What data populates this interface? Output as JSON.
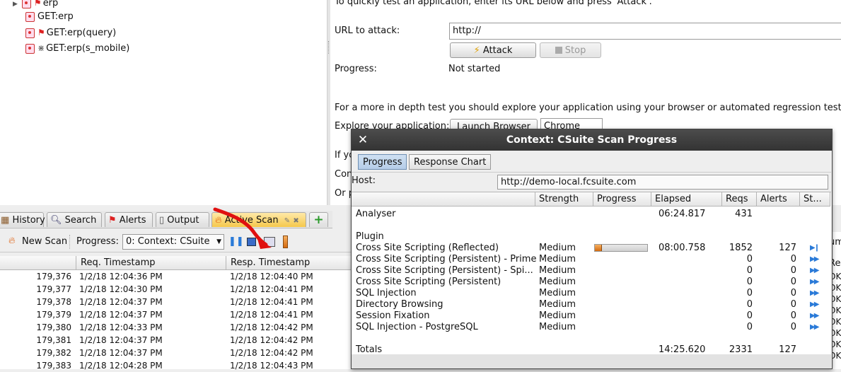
{
  "tree": {
    "items": [
      {
        "label": "erp",
        "type": "folder"
      },
      {
        "label": "GET:erp",
        "type": "plain"
      },
      {
        "label": "GET:erp(query)",
        "type": "flag"
      },
      {
        "label": "GET:erp(s_mobile)",
        "type": "bug"
      }
    ]
  },
  "quick": {
    "intro": "To quickly test an application, enter its URL below and press 'Attack'.",
    "url_label": "URL to attack:",
    "url_value": "http://",
    "attack_label": "Attack",
    "stop_label": "Stop",
    "progress_label": "Progress:",
    "progress_value": "Not started",
    "explore_text": "For a more in depth test you should explore your application using your browser or automated regression tests whi",
    "explore_label": "Explore your application:",
    "launch_label": "Launch Browser",
    "browser_value": "Chrome",
    "if_prefix": "If yo",
    "con_prefix": "Con",
    "or_prefix": "Or p"
  },
  "tabs": [
    {
      "label": "History",
      "icon": "history-icon"
    },
    {
      "label": "Search",
      "icon": "search-icon"
    },
    {
      "label": "Alerts",
      "icon": "alert-flag-icon"
    },
    {
      "label": "Output",
      "icon": "document-icon"
    },
    {
      "label": "Active Scan",
      "icon": "flame-icon",
      "active": true
    }
  ],
  "toolbar": {
    "new_scan": "New Scan",
    "progress_label": "Progress:",
    "progress_select": "0: Context: CSuite"
  },
  "table": {
    "headers": [
      "",
      "Req. Timestamp",
      "Resp. Timestamp"
    ],
    "rows": [
      {
        "id": "179,376",
        "req": "1/2/18 12:04:36 PM",
        "resp": "1/2/18 12:04:40 PM",
        "code": "OK"
      },
      {
        "id": "179,377",
        "req": "1/2/18 12:04:30 PM",
        "resp": "1/2/18 12:04:41 PM",
        "code": "OK"
      },
      {
        "id": "179,378",
        "req": "1/2/18 12:04:37 PM",
        "resp": "1/2/18 12:04:41 PM",
        "code": "OK"
      },
      {
        "id": "179,379",
        "req": "1/2/18 12:04:37 PM",
        "resp": "1/2/18 12:04:41 PM",
        "code": "OK"
      },
      {
        "id": "179,380",
        "req": "1/2/18 12:04:33 PM",
        "resp": "1/2/18 12:04:42 PM",
        "code": "OK"
      },
      {
        "id": "179,381",
        "req": "1/2/18 12:04:37 PM",
        "resp": "1/2/18 12:04:42 PM",
        "code": "OK"
      },
      {
        "id": "179,382",
        "req": "1/2/18 12:04:37 PM",
        "resp": "1/2/18 12:04:42 PM",
        "code": "OK"
      },
      {
        "id": "179,383",
        "req": "1/2/18 12:04:28 PM",
        "resp": "1/2/18 12:04:43 PM",
        "code": "OK"
      }
    ],
    "right_header_fragment": "Rea",
    "right_top_fragment": "um"
  },
  "dialog": {
    "title": "Context: CSuite Scan Progress",
    "tabs": [
      "Progress",
      "Response Chart"
    ],
    "host_label": "Host:",
    "host_value": "http://demo-local.fcsuite.com",
    "headers": [
      "",
      "Strength",
      "Progress",
      "Elapsed",
      "Reqs",
      "Alerts",
      "St..."
    ],
    "analyser": {
      "name": "Analyser",
      "elapsed": "06:24.817",
      "reqs": "431"
    },
    "plugin_heading": "Plugin",
    "plugins": [
      {
        "name": "Cross Site Scripting (Reflected)",
        "strength": "Medium",
        "progress": 0.12,
        "elapsed": "08:00.758",
        "reqs": "1852",
        "alerts": "127",
        "status": "running"
      },
      {
        "name": "Cross Site Scripting (Persistent) - Prime",
        "strength": "Medium",
        "progress": null,
        "elapsed": "",
        "reqs": "0",
        "alerts": "0",
        "status": "pending"
      },
      {
        "name": "Cross Site Scripting (Persistent) - Spi...",
        "strength": "Medium",
        "progress": null,
        "elapsed": "",
        "reqs": "0",
        "alerts": "0",
        "status": "pending"
      },
      {
        "name": "Cross Site Scripting (Persistent)",
        "strength": "Medium",
        "progress": null,
        "elapsed": "",
        "reqs": "0",
        "alerts": "0",
        "status": "pending"
      },
      {
        "name": "SQL Injection",
        "strength": "Medium",
        "progress": null,
        "elapsed": "",
        "reqs": "0",
        "alerts": "0",
        "status": "pending"
      },
      {
        "name": "Directory Browsing",
        "strength": "Medium",
        "progress": null,
        "elapsed": "",
        "reqs": "0",
        "alerts": "0",
        "status": "pending"
      },
      {
        "name": "Session Fixation",
        "strength": "Medium",
        "progress": null,
        "elapsed": "",
        "reqs": "0",
        "alerts": "0",
        "status": "pending"
      },
      {
        "name": "SQL Injection - PostgreSQL",
        "strength": "Medium",
        "progress": null,
        "elapsed": "",
        "reqs": "0",
        "alerts": "0",
        "status": "pending"
      }
    ],
    "totals": {
      "name": "Totals",
      "elapsed": "14:25.620",
      "reqs": "2331",
      "alerts": "127"
    }
  },
  "annotation": {
    "arrow_color": "#e01010"
  }
}
